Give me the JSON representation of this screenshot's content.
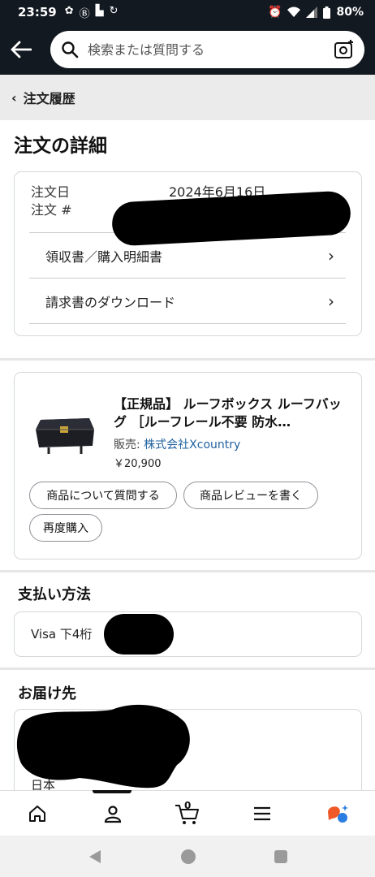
{
  "status_bar": {
    "time": "23:59",
    "battery": "80%"
  },
  "header": {
    "search_placeholder": "検索または質問する"
  },
  "breadcrumb": {
    "label": "注文履歴"
  },
  "page_title": "注文の詳細",
  "order_info": {
    "date_label": "注文日",
    "number_label": "注文 #",
    "date_value": "2024年6月16日",
    "links": [
      {
        "label": "領収書／購入明細書"
      },
      {
        "label": "請求書のダウンロード"
      }
    ]
  },
  "product": {
    "title": "【正規品】 ルーフボックス ルーフバッグ ［ルーフレール不要 防水…",
    "seller_prefix": "販売: ",
    "seller_name": "株式会社Xcountry",
    "price": "￥20,900",
    "buttons": {
      "ask": "商品について質問する",
      "review": "商品レビューを書く",
      "rebuy": "再度購入"
    }
  },
  "payment": {
    "section_title": "支払い方法",
    "text": "Visa 下4桁"
  },
  "delivery": {
    "section_title": "お届け先",
    "country": "日本"
  },
  "bottom_nav": {
    "cart_count": "0"
  }
}
